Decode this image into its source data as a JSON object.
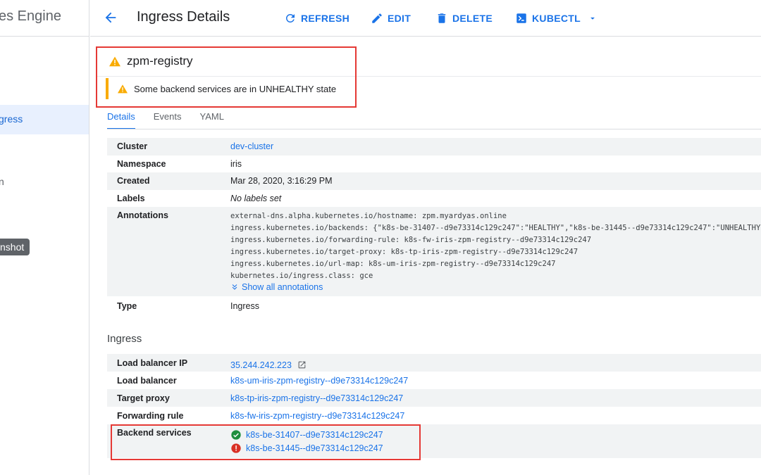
{
  "sidebar": {
    "title": "es Engine",
    "active_item": "gress",
    "item_n": "n",
    "tooltip": "nshot"
  },
  "topbar": {
    "title": "Ingress Details",
    "refresh": "REFRESH",
    "edit": "EDIT",
    "delete": "DELETE",
    "kubectl": "KUBECTL"
  },
  "resource": {
    "name": "zpm-registry",
    "warning": "Some backend services are in UNHEALTHY state"
  },
  "tabs": [
    "Details",
    "Events",
    "YAML"
  ],
  "details": {
    "cluster_label": "Cluster",
    "cluster_value": "dev-cluster",
    "namespace_label": "Namespace",
    "namespace_value": "iris",
    "created_label": "Created",
    "created_value": "Mar 28, 2020, 3:16:29 PM",
    "labels_label": "Labels",
    "labels_value": "No labels set",
    "annotations_label": "Annotations",
    "annotations": [
      "external-dns.alpha.kubernetes.io/hostname: zpm.myardyas.online",
      "ingress.kubernetes.io/backends: {\"k8s-be-31407--d9e73314c129c247\":\"HEALTHY\",\"k8s-be-31445--d9e73314c129c247\":\"UNHEALTHY\"}",
      "ingress.kubernetes.io/forwarding-rule: k8s-fw-iris-zpm-registry--d9e73314c129c247",
      "ingress.kubernetes.io/target-proxy: k8s-tp-iris-zpm-registry--d9e73314c129c247",
      "ingress.kubernetes.io/url-map: k8s-um-iris-zpm-registry--d9e73314c129c247",
      "kubernetes.io/ingress.class: gce"
    ],
    "show_all": "Show all annotations",
    "type_label": "Type",
    "type_value": "Ingress"
  },
  "ingress": {
    "section_title": "Ingress",
    "lb_ip_label": "Load balancer IP",
    "lb_ip_value": "35.244.242.223",
    "lb_label": "Load balancer",
    "lb_value": "k8s-um-iris-zpm-registry--d9e73314c129c247",
    "tp_label": "Target proxy",
    "tp_value": "k8s-tp-iris-zpm-registry--d9e73314c129c247",
    "fr_label": "Forwarding rule",
    "fr_value": "k8s-fw-iris-zpm-registry--d9e73314c129c247",
    "bs_label": "Backend services",
    "backends": [
      {
        "name": "k8s-be-31407--d9e73314c129c247",
        "status": "healthy"
      },
      {
        "name": "k8s-be-31445--d9e73314c129c247",
        "status": "unhealthy"
      }
    ]
  },
  "colors": {
    "accent": "#1a73e8",
    "warning": "#f9ab00",
    "healthy": "#1e8e3e",
    "error": "#d93025",
    "highlight_box": "#e53935"
  }
}
